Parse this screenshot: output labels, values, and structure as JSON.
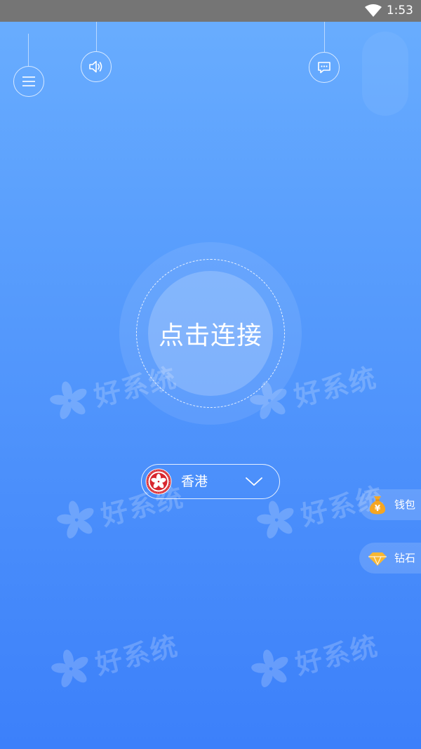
{
  "status_bar": {
    "time": "1:53",
    "wifi_icon": "wifi-icon"
  },
  "top_buttons": {
    "menu_icon": "menu-icon",
    "sound_icon": "speaker-icon",
    "message_icon": "message-icon"
  },
  "connect": {
    "label": "点击连接"
  },
  "region": {
    "name": "香港",
    "flag_icon": "hong-kong-flag-icon",
    "dropdown_icon": "chevron-down-icon"
  },
  "side_actions": {
    "wallet": {
      "label": "钱包",
      "icon": "money-bag-icon"
    },
    "diamond": {
      "label": "钻石",
      "icon": "diamond-icon"
    }
  },
  "watermark": {
    "text": "好系统"
  },
  "colors": {
    "background_top": "#6aaefe",
    "background_bottom": "#3c80fa",
    "status_bar": "#757575",
    "flag_red": "#d7262e",
    "coin_orange": "#f5a623",
    "diamond_yellow": "#f7b733"
  }
}
